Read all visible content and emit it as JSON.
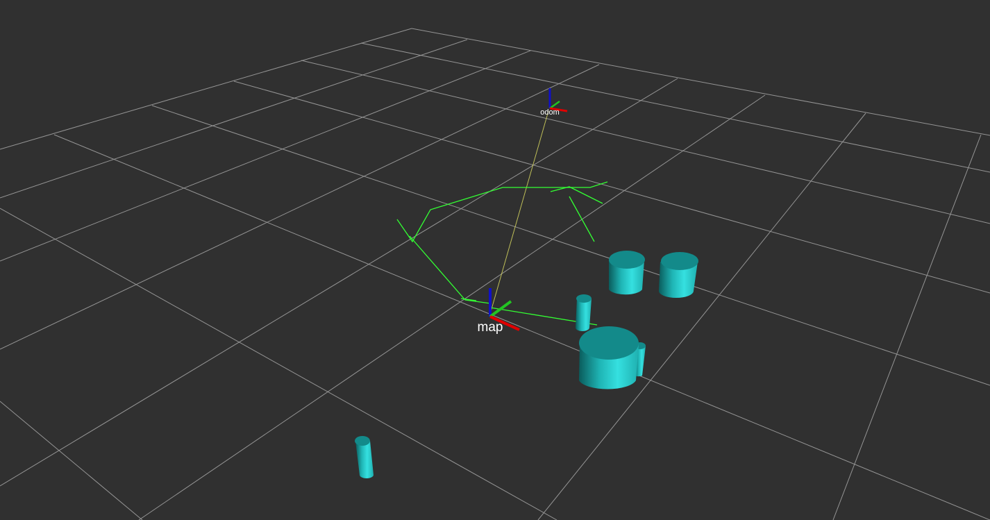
{
  "viewport": {
    "background_color": "#303030",
    "grid_color": "#a0a0a0"
  },
  "frames": {
    "map": {
      "label": "map"
    },
    "odom": {
      "label": "odom"
    }
  },
  "axes_colors": {
    "x": "#e00000",
    "y": "#22c422",
    "z": "#1010c8"
  },
  "laser_scan_color": "#33ff33",
  "tf_link_color": "#d8d860",
  "obstacle_colors": {
    "top": "#138a8a",
    "side_light": "#2fd8d8",
    "side_dark": "#0a5c5c"
  }
}
